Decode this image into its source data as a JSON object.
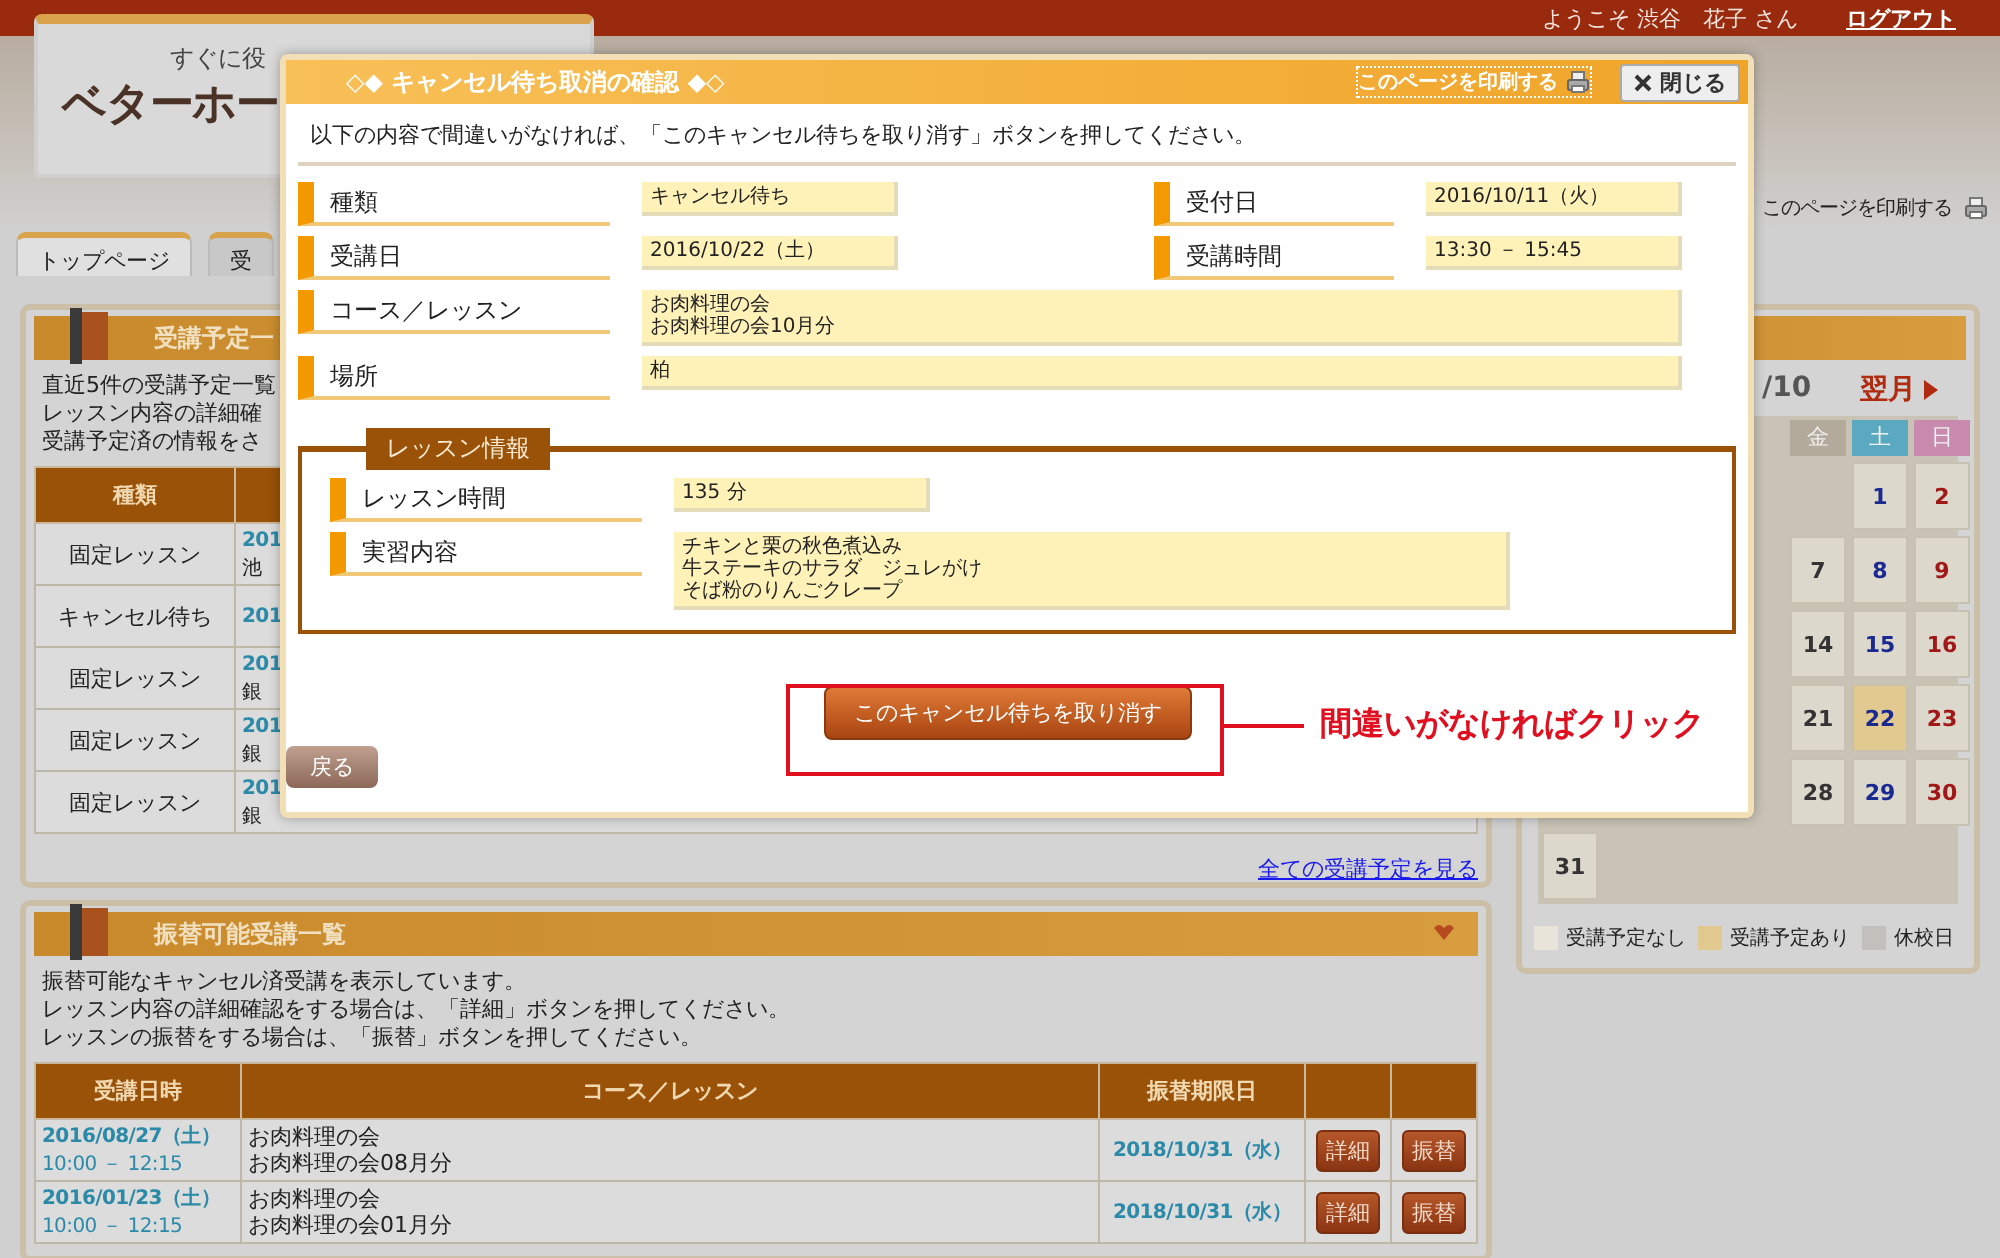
{
  "top_bar": {
    "welcome": "ようこそ 渋谷　花子 さん",
    "logout": "ログアウト"
  },
  "logo": {
    "tagline": "すぐに役",
    "name": "ベターホー"
  },
  "print_link": "このページを印刷する",
  "tabs": [
    {
      "label": "トップページ",
      "selected": true
    },
    {
      "label": "受",
      "selected": false
    }
  ],
  "schedule": {
    "title": "受講予定一",
    "intro": [
      "直近5件の受講予定一覧",
      "レッスン内容の詳細確",
      "受講予定済の情報をさ"
    ],
    "columns": [
      "種類"
    ],
    "rows": [
      {
        "type": "固定レッスン",
        "date": "201",
        "place": "池"
      },
      {
        "type": "キャンセル待ち",
        "date": "201"
      },
      {
        "type": "固定レッスン",
        "date": "201",
        "place": "銀"
      },
      {
        "type": "固定レッスン",
        "date": "201",
        "place": "銀"
      },
      {
        "type": "固定レッスン",
        "date": "201",
        "place": "銀"
      }
    ],
    "link": "全ての受講予定を見る"
  },
  "calendar": {
    "month": "/10",
    "next": "翌月",
    "weekdays": [
      "金",
      "土",
      "日"
    ],
    "weeks": [
      [
        {
          "kind": "blank"
        },
        {
          "kind": "blank"
        },
        {
          "kind": "blank"
        },
        {
          "kind": "blank"
        },
        {
          "kind": "blank"
        },
        {
          "kind": "day",
          "day": "1",
          "scheduled": false
        },
        {
          "kind": "day",
          "day": "2",
          "scheduled": false
        }
      ],
      [
        {
          "kind": "blank"
        },
        {
          "kind": "blank"
        },
        {
          "kind": "blank"
        },
        {
          "kind": "blank"
        },
        {
          "kind": "day",
          "day": "7",
          "scheduled": false
        },
        {
          "kind": "day",
          "day": "8",
          "scheduled": false
        },
        {
          "kind": "day",
          "day": "9",
          "scheduled": false
        }
      ],
      [
        {
          "kind": "blank"
        },
        {
          "kind": "blank"
        },
        {
          "kind": "blank"
        },
        {
          "kind": "blank"
        },
        {
          "kind": "day",
          "day": "14",
          "scheduled": false
        },
        {
          "kind": "day",
          "day": "15",
          "scheduled": false
        },
        {
          "kind": "day",
          "day": "16",
          "scheduled": false
        }
      ],
      [
        {
          "kind": "blank"
        },
        {
          "kind": "blank"
        },
        {
          "kind": "blank"
        },
        {
          "kind": "blank"
        },
        {
          "kind": "day",
          "day": "21",
          "scheduled": false
        },
        {
          "kind": "day",
          "day": "22",
          "scheduled": true
        },
        {
          "kind": "day",
          "day": "23",
          "scheduled": false
        }
      ],
      [
        {
          "kind": "blank"
        },
        {
          "kind": "blank"
        },
        {
          "kind": "blank"
        },
        {
          "kind": "blank"
        },
        {
          "kind": "day",
          "day": "28",
          "scheduled": false
        },
        {
          "kind": "day",
          "day": "29",
          "scheduled": false
        },
        {
          "kind": "day",
          "day": "30",
          "scheduled": false
        }
      ],
      [
        {
          "kind": "day",
          "day": "31",
          "scheduled": false
        }
      ]
    ],
    "legend": [
      {
        "label": "受講予定なし",
        "color": "#e8e4da"
      },
      {
        "label": "受講予定あり",
        "color": "#e2c98f"
      },
      {
        "label": "休校日",
        "color": "#c2c0bc"
      }
    ]
  },
  "transfer": {
    "title": "振替可能受講一覧",
    "intro": [
      "振替可能なキャンセル済受講を表示しています。",
      "レッスン内容の詳細確認をする場合は、「詳細」ボタンを押してください。",
      "レッスンの振替をする場合は、「振替」ボタンを押してください。"
    ],
    "columns": [
      "受講日時",
      "コース／レッスン",
      "振替期限日"
    ],
    "rows": [
      {
        "date": "2016/08/27（土）",
        "time": "10:00 － 12:15",
        "course": "お肉料理の会",
        "lesson": "お肉料理の会08月分",
        "deadline": "2018/10/31（水）",
        "detail": "詳細",
        "swap": "振替"
      },
      {
        "date": "2016/01/23（土）",
        "time": "10:00 － 12:15",
        "course": "お肉料理の会",
        "lesson": "お肉料理の会01月分",
        "deadline": "2018/10/31（水）",
        "detail": "詳細",
        "swap": "振替"
      }
    ]
  },
  "dialog": {
    "title": "◇◆ キャンセル待ち取消の確認 ◆◇",
    "print": "このページを印刷する",
    "close": "閉じる",
    "instruction": "以下の内容で間違いがなければ、「このキャンセル待ちを取り消す」ボタンを押してください。",
    "rows": [
      [
        {
          "label": "種類",
          "lines": [
            "キャンセル待ち"
          ]
        },
        {
          "label": "受付日",
          "lines": [
            "2016/10/11（火）"
          ]
        }
      ],
      [
        {
          "label": "受講日",
          "lines": [
            "2016/10/22（土）"
          ]
        },
        {
          "label": "受講時間",
          "lines": [
            "13:30 － 15:45"
          ]
        }
      ],
      [
        {
          "label": "コース／レッスン",
          "lines": [
            "お肉料理の会",
            "お肉料理の会10月分"
          ]
        }
      ],
      [
        {
          "label": "場所",
          "lines": [
            "柏"
          ]
        }
      ]
    ],
    "lesson_info": {
      "legend": "レッスン情報",
      "fields": [
        {
          "label": "レッスン時間",
          "kind": "short",
          "lines": [
            "135 分"
          ]
        },
        {
          "label": "実習内容",
          "kind": "wide",
          "lines": [
            "チキンと栗の秋色煮込み",
            "牛ステーキのサラダ　ジュレがけ",
            "そば粉のりんごクレープ"
          ]
        }
      ]
    },
    "confirm_button": "このキャンセル待ちを取り消す",
    "back_button": "戻る"
  },
  "callout": {
    "text": "間違いがなければクリック"
  }
}
